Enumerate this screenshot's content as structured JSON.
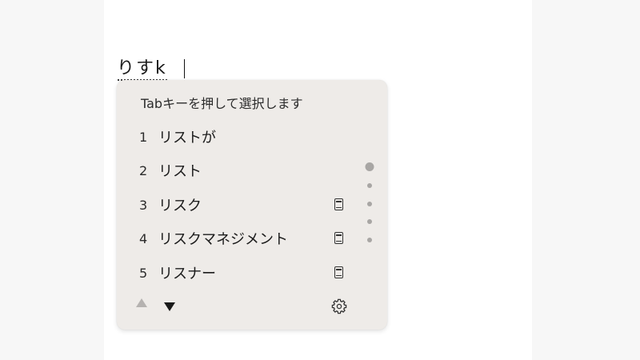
{
  "composition": {
    "text": "りすk"
  },
  "ime": {
    "hint": "Tabキーを押して選択します",
    "candidates": [
      {
        "num": "1",
        "word": "リストが",
        "dict": false
      },
      {
        "num": "2",
        "word": "リスト",
        "dict": false
      },
      {
        "num": "3",
        "word": "リスク",
        "dict": true
      },
      {
        "num": "4",
        "word": "リスクマネジメント",
        "dict": true
      },
      {
        "num": "5",
        "word": "リスナー",
        "dict": true
      }
    ],
    "icons": {
      "dictionary": "dictionary-icon",
      "prev": "triangle-up-icon",
      "next": "triangle-down-icon",
      "settings": "gear-icon"
    },
    "colors": {
      "panel": "#eeebe8",
      "text": "#1b1b1b",
      "disabled": "#b5b2b0"
    }
  }
}
